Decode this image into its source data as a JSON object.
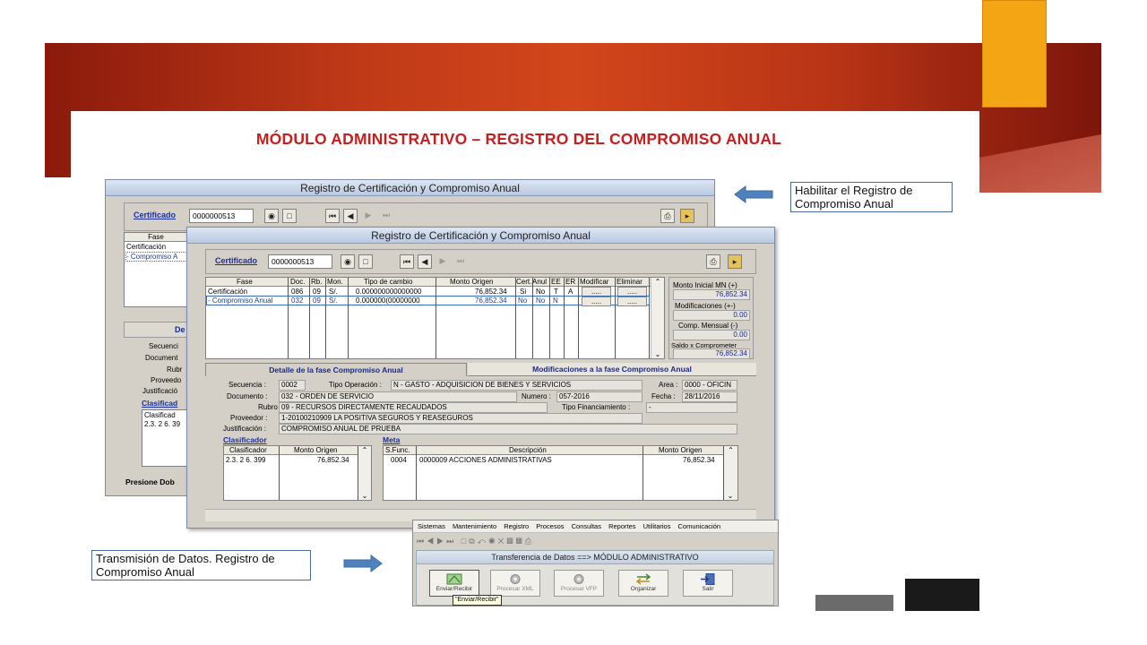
{
  "slide": {
    "title": "MÓDULO ADMINISTRATIVO – REGISTRO DEL COMPROMISO ANUAL"
  },
  "callouts": {
    "top_right": "Habilitar el Registro de Compromiso Anual",
    "bottom_left": "Transmisión de Datos.  Registro de Compromiso Anual"
  },
  "colors": {
    "banner": "#c03a18",
    "title": "#c81e1e",
    "accent_tab": "#f3a513",
    "link": "#1a2f9c"
  },
  "back_window": {
    "title": "Registro de Certificación y Compromiso Anual",
    "certificado_label": "Certificado",
    "certificado_value": "0000000513",
    "fase_header": "Fase",
    "rows": [
      "Certificación",
      "- Compromiso A"
    ],
    "detail_tab": "De",
    "field_labels": [
      "Secuenci",
      "Document",
      "Rubr",
      "Proveedo",
      "Justificació"
    ],
    "clasificador_link": "Clasificad",
    "clasificador_header": "Clasificad",
    "clasificador_value": "2.3. 2 6. 39",
    "footer": "Presione Dob"
  },
  "front_window": {
    "title": "Registro de Certificación y Compromiso Anual",
    "certificado_label": "Certificado",
    "certificado_value": "0000000513",
    "grid_headers": [
      "Fase",
      "Doc.",
      "Rb.",
      "Mon.",
      "Tipo de cambio",
      "Monto Origen",
      "Cert.",
      "Anul",
      "EE",
      "ER",
      "Modificar",
      "Eliminar"
    ],
    "grid_rows": [
      {
        "fase": "Certificación",
        "doc": "086",
        "rb": "09",
        "mon": "S/.",
        "tipo": "0.000000000000000",
        "monto": "76,852.34",
        "cert": "Si",
        "anul": "No",
        "ee": "T",
        "er": "A",
        "mod": ".....",
        "del": "....."
      },
      {
        "fase": "- Compromiso Anual",
        "doc": "032",
        "rb": "09",
        "mon": "S/.",
        "tipo": "0.000000(00000000",
        "monto": "76,852.34",
        "cert": "No",
        "anul": "No",
        "ee": "N",
        "er": "",
        "mod": ".....",
        "del": "....."
      }
    ],
    "summary": {
      "monto_inicial_label": "Monto Inicial MN (+)",
      "monto_inicial_value": "76,852.34",
      "modificaciones_label": "Modificaciones (+-)",
      "modificaciones_value": "0.00",
      "comp_mensual_label": "Comp. Mensual (-)",
      "comp_mensual_value": "0.00",
      "saldo_label": "Saldo x Comprometer",
      "saldo_value": "76,852.34"
    },
    "tabs": [
      "Detalle de la fase Compromiso Anual",
      "Modificaciones a la fase Compromiso Anual"
    ],
    "detail": {
      "secuencia_label": "Secuencia :",
      "secuencia_value": "0002",
      "tipo_op_label": "Tipo Operación :",
      "tipo_op_value": "N  - GASTO - ADQUISICION DE BIENES Y SERVICIOS",
      "area_label": "Area :",
      "area_value": "0000 - OFICIN",
      "documento_label": "Documento :",
      "documento_value": "032 - ORDEN DE SERVICIO",
      "numero_label": "Numero :",
      "numero_value": "057-2016",
      "fecha_label": "Fecha :",
      "fecha_value": "28/11/2016",
      "rubro_label": "Rubro :",
      "rubro_value": "09 - RECURSOS DIRECTAMENTE RECAUDADOS",
      "tipo_fin_label": "Tipo Financiamiento :",
      "tipo_fin_value": "-",
      "proveedor_label": "Proveedor :",
      "proveedor_value": "1-20100210909  LA POSITIVA SEGUROS Y REASEGUROS",
      "justificacion_label": "Justificación :",
      "justificacion_value": "COMPROMISO ANUAL DE PRUEBA"
    },
    "clasificador": {
      "link": "Clasificador",
      "headers": [
        "Clasificador",
        "Monto Origen"
      ],
      "row": [
        "2.3. 2 6. 399",
        "76,852.34"
      ]
    },
    "meta": {
      "link": "Meta",
      "headers": [
        "S.Func.",
        "Descripción",
        "Monto Origen"
      ],
      "row": [
        "0004",
        "0000009  ACCIONES ADMINISTRATIVAS",
        "76,852.34"
      ]
    }
  },
  "menu_window": {
    "menu": [
      "Sistemas",
      "Mantenimiento",
      "Registro",
      "Procesos",
      "Consultas",
      "Reportes",
      "Utilitarios",
      "Comunicación"
    ],
    "inner_title": "Transferencia de Datos ==> MÓDULO ADMINISTRATIVO",
    "buttons": [
      "Enviar/Recibir",
      "Procesar XML",
      "Procesar VFP",
      "Organizar",
      "Salir"
    ],
    "tooltip": "\"Enviar/Recibir\""
  }
}
